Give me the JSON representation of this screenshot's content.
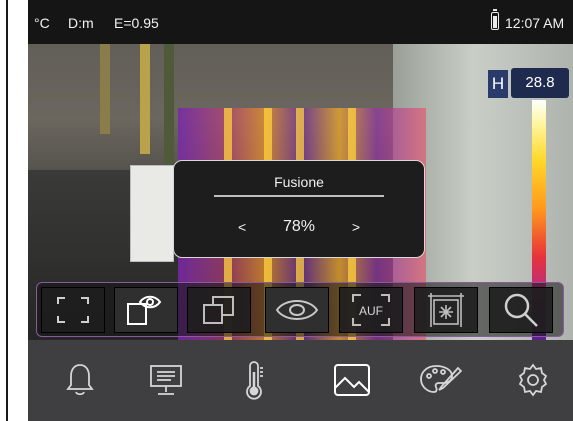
{
  "status_bar": {
    "unit": "°C",
    "distance": "D:m",
    "emissivity": "E=0.95",
    "time": "12:07 AM",
    "battery_icon": "battery-icon"
  },
  "scale": {
    "mode_label": "H",
    "high_value": "28.8"
  },
  "dialog": {
    "title": "Fusione",
    "decrease_label": "<",
    "value": "78%",
    "increase_label": ">"
  },
  "mode_toolbar": {
    "buttons": [
      {
        "icon": "full-frame-icon"
      },
      {
        "icon": "picture-in-picture-eye-icon",
        "selected": true
      },
      {
        "icon": "picture-in-picture-icon"
      },
      {
        "icon": "eye-visible-icon",
        "selected": true
      },
      {
        "icon": "auto-focus-icon"
      },
      {
        "icon": "center-point-icon"
      },
      {
        "icon": "zoom-icon"
      }
    ]
  },
  "bottom_menu": {
    "items": [
      {
        "icon": "alarm-bell-icon"
      },
      {
        "icon": "display-monitor-icon"
      },
      {
        "icon": "thermometer-icon"
      },
      {
        "icon": "image-mode-icon",
        "selected": true
      },
      {
        "icon": "palette-icon"
      },
      {
        "icon": "settings-gear-icon"
      }
    ]
  },
  "colors": {
    "scale_gradient": [
      "#ffffff",
      "#ffd92a",
      "#ff9a1c",
      "#e8343a",
      "#b02a8a",
      "#5a1f8e"
    ],
    "toolbar_border": "#8a5aa0",
    "menu_background": "#3f3f41",
    "dialog_background": "#1d1d1d"
  }
}
